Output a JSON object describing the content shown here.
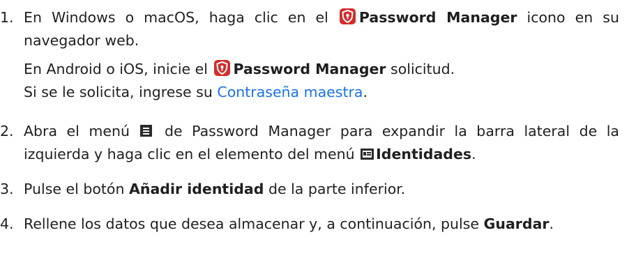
{
  "steps": [
    {
      "number": "1.",
      "part1": "En Windows o macOS, haga clic en el",
      "bold1": "Password Manager",
      "part2": "icono en su navegador web.",
      "sub1_part1": "En Android o iOS, inicie el",
      "sub1_bold": "Password Manager",
      "sub1_part2": "solicitud.",
      "sub2_part1": "Si se le solicita, ingrese su",
      "sub2_link": "Contraseña maestra",
      "sub2_part2": "."
    },
    {
      "number": "2.",
      "part1": "Abra el menú",
      "part2": "de Password Manager para expandir la barra lateral de la izquierda y haga clic en el elemento del menú",
      "bold1": "Identidades",
      "part3": "."
    },
    {
      "number": "3.",
      "part1": "Pulse el botón",
      "bold1": "Añadir identidad",
      "part2": "de la parte inferior."
    },
    {
      "number": "4.",
      "part1": "Rellene los datos que desea almacenar y, a continuación, pulse",
      "bold1": "Guardar",
      "part2": "."
    }
  ],
  "icons": {
    "app": "password-manager-shield-icon",
    "menu": "hamburger-menu-icon",
    "identity": "id-card-icon"
  },
  "colors": {
    "link": "#1a73e8",
    "app_icon_bg": "#d42c2c",
    "icon_dark": "#2b2b2b",
    "text": "#1f1f1f"
  }
}
